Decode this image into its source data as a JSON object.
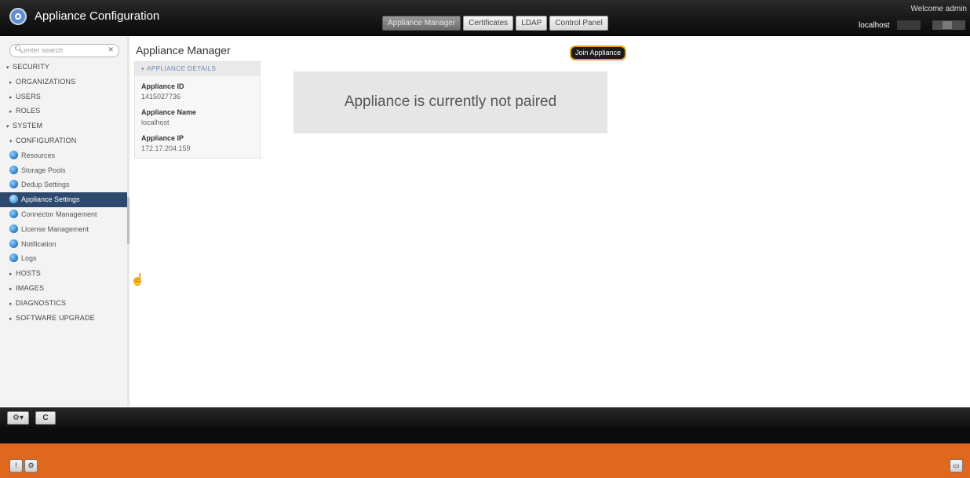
{
  "app": {
    "title": "Appliance Configuration"
  },
  "header": {
    "tabs": [
      {
        "label": "Appliance Manager",
        "active": true
      },
      {
        "label": "Certificates",
        "active": false
      },
      {
        "label": "LDAP",
        "active": false
      },
      {
        "label": "Control Panel",
        "active": false
      }
    ],
    "welcome": "Welcome admin",
    "host": "localhost"
  },
  "search": {
    "placeholder": "enter search",
    "value": ""
  },
  "sidebar": {
    "items": [
      {
        "label": "SECURITY",
        "level": 0,
        "arrow": "▾"
      },
      {
        "label": "ORGANIZATIONS",
        "level": 1,
        "arrow": "▸"
      },
      {
        "label": "USERS",
        "level": 1,
        "arrow": "▸"
      },
      {
        "label": "ROLES",
        "level": 1,
        "arrow": "▸"
      },
      {
        "label": "SYSTEM",
        "level": 0,
        "arrow": "▾"
      },
      {
        "label": "CONFIGURATION",
        "level": 1,
        "arrow": "▾"
      },
      {
        "label": "Resources",
        "level": 2
      },
      {
        "label": "Storage Pools",
        "level": 2
      },
      {
        "label": "Dedup Settings",
        "level": 2
      },
      {
        "label": "Appliance Settings",
        "level": 2,
        "selected": true
      },
      {
        "label": "Connector Management",
        "level": 2
      },
      {
        "label": "License Management",
        "level": 2
      },
      {
        "label": "Notification",
        "level": 2
      },
      {
        "label": "Logs",
        "level": 2
      },
      {
        "label": "HOSTS",
        "level": 1,
        "arrow": "▸"
      },
      {
        "label": "IMAGES",
        "level": 1,
        "arrow": "▸"
      },
      {
        "label": "DIAGNOSTICS",
        "level": 1,
        "arrow": "▸"
      },
      {
        "label": "SOFTWARE UPGRADE",
        "level": 1,
        "arrow": "▸"
      }
    ]
  },
  "main": {
    "title": "Appliance Manager",
    "details": {
      "header": "APPLIANCE DETAILS",
      "id_label": "Appliance ID",
      "id_value": "1415027736",
      "name_label": "Appliance Name",
      "name_value": "localhost",
      "ip_label": "Appliance IP",
      "ip_value": "172.17.204.159"
    },
    "join_button": "Join Appliance",
    "status": "Appliance is currently not paired"
  },
  "toolbar": {
    "gear_label": "⚙▾",
    "refresh_label": "C"
  },
  "footer": {
    "btn1": "!",
    "btn2": "⚙",
    "btn3": "▭"
  },
  "colors": {
    "accent_orange": "#e0681e",
    "selected_bg": "#2d4a6e",
    "button_ring": "#e0a020"
  },
  "icons": [
    "app-logo-icon",
    "search-icon",
    "clear-icon",
    "globe-icon",
    "gear-icon",
    "refresh-icon",
    "hand-cursor-icon"
  ]
}
